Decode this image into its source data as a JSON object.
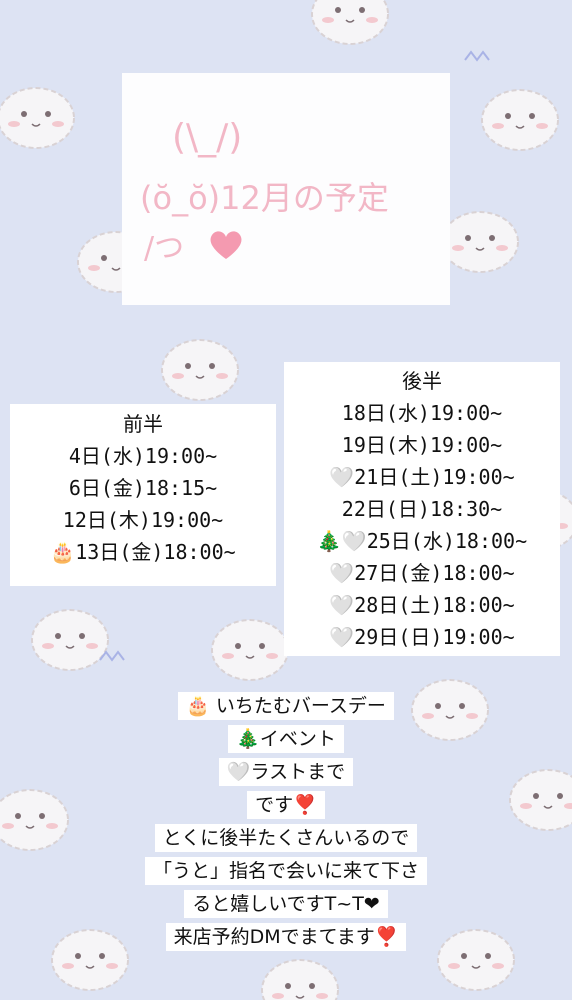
{
  "title": {
    "line1": "(\\_/)",
    "line2": "(ŏ_ŏ)12月の予定",
    "line3": "/つ"
  },
  "first_half": {
    "header": "前半",
    "rows": [
      "4日(水)19:00~",
      "6日(金)18:15~",
      "12日(木)19:00~",
      "🎂13日(金)18:00~"
    ]
  },
  "second_half": {
    "header": "後半",
    "rows": [
      "18日(水)19:00~",
      "19日(木)19:00~",
      "🤍21日(土)19:00~",
      "22日(日)18:30~",
      "🎄🤍25日(水)18:00~",
      "🤍27日(金)18:00~",
      "🤍28日(土)18:00~",
      "🤍29日(日)19:00~"
    ]
  },
  "message": [
    "🎂 いちたむバースデー",
    "🎄イベント",
    "🤍ラストまで",
    "です❣️",
    "とくに後半たくさんいるので",
    "「うと」指名で会いに来て下さ",
    "ると嬉しいですT~T❤",
    "来店予約DMでまてます❣️"
  ],
  "colors": {
    "background": "#dde3f3",
    "title_pink": "#f2b7c6",
    "heart": "#f49ab0"
  }
}
